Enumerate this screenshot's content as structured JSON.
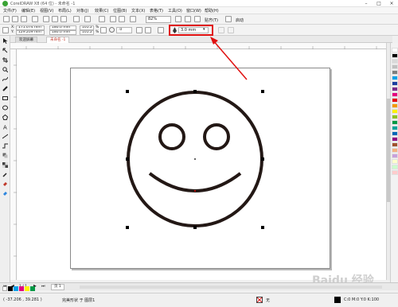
{
  "window": {
    "title": "CorelDRAW X8 (64 位) - 未命名 -1"
  },
  "menu": [
    "文件(F)",
    "编辑(E)",
    "视图(V)",
    "布局(L)",
    "对象(J)",
    "效果(C)",
    "位图(B)",
    "文本(X)",
    "表格(T)",
    "工具(O)",
    "窗口(W)",
    "帮助(H)"
  ],
  "toolbar": {
    "zoom": "82%",
    "snap_label": "贴齐(T)",
    "launch_label": "启动"
  },
  "propbar": {
    "x": "171.074 mm",
    "y": "129.209 mm",
    "w": "180.0 mm",
    "h": "180.0 mm",
    "scale_x": "105.2",
    "scale_y": "105.2",
    "pct": "%",
    "angle": ".0",
    "outline_width": "3.0 mm"
  },
  "tabs": {
    "welcome": "欢迎屏幕",
    "doc": "未命名 -1"
  },
  "pagenav": {
    "page": "页 1",
    "counter": "1 / 1"
  },
  "status": {
    "coords": "( -37.206 , 39.281 )",
    "object": "完美形状 于 图层1",
    "fill_none": "无",
    "outline": "C:0 M:0 Y:0 K:100",
    "outline_width": "3.000 mm"
  },
  "colors": {
    "accent": "#e01010",
    "palette": [
      "#ffffff",
      "#000000",
      "#d9d9d9",
      "#bfbfbf",
      "#7f7f7f",
      "#00a0e9",
      "#1a3fa0",
      "#7a2a8a",
      "#e4007f",
      "#e60012",
      "#f39800",
      "#fff100",
      "#8fc31f",
      "#009944",
      "#00a29a",
      "#0068b7",
      "#920783",
      "#a0522d",
      "#f4b183",
      "#c9a0dc",
      "#ffffcc",
      "#ccffcc",
      "#ffcccc"
    ]
  },
  "icons": {
    "pointer": "pointer-icon",
    "shape": "shape-edit-icon",
    "crop": "crop-icon",
    "zoom": "zoom-icon",
    "freehand": "freehand-icon",
    "rectangle": "rectangle-icon",
    "ellipse": "ellipse-icon",
    "polygon": "polygon-icon",
    "text": "text-icon",
    "parallel": "dimension-icon",
    "connector": "connector-icon",
    "shadow": "shadow-icon",
    "transparency": "transparency-icon",
    "eyedropper": "eyedropper-icon",
    "fill": "fill-icon",
    "smart_fill": "smart-fill-icon"
  },
  "watermark": "Baidu 经验"
}
